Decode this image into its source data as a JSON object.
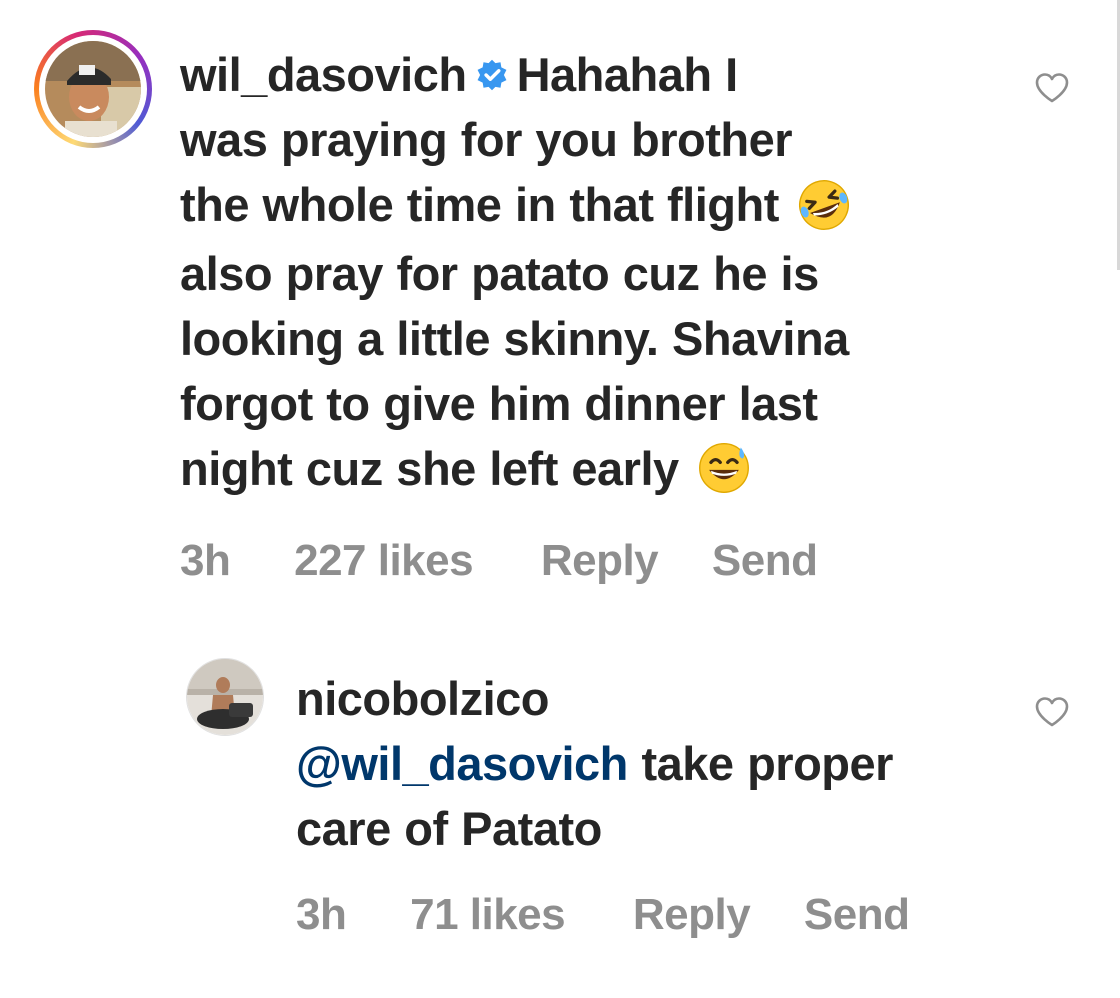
{
  "comments": [
    {
      "username": "wil_dasovich",
      "verified": true,
      "text_lines": [
        "Hahahah I",
        "was praying for you brother",
        "the whole time in that flight",
        "also pray for patato cuz he is",
        "looking a little skinny. Shavina",
        "forgot to give him dinner last",
        "night cuz she left early"
      ],
      "time": "3h",
      "likes": "227 likes",
      "reply_label": "Reply",
      "send_label": "Send"
    },
    {
      "username": "nicobolzico",
      "verified": false,
      "mention": "@wil_dasovich",
      "text_lines": [
        "take proper",
        "care of Patato"
      ],
      "time": "3h",
      "likes": "71 likes",
      "reply_label": "Reply",
      "send_label": "Send"
    }
  ],
  "icons": {
    "verified": "verified-badge-icon",
    "like": "heart-outline-icon",
    "emoji_laugh": "rolling-laughing-emoji",
    "emoji_sweat": "grinning-sweat-emoji"
  },
  "colors": {
    "text": "#262626",
    "meta": "#8e8e8e",
    "mention": "#00376b",
    "verified": "#3897f0"
  }
}
